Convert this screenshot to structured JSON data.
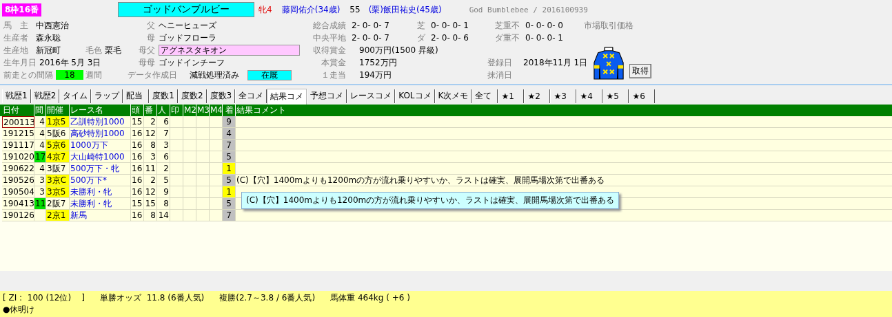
{
  "header": {
    "frame": "8枠16番",
    "horse_name": "ゴッドバンブルビー",
    "sex_age": "牝4",
    "jockey": "藤岡佑介(34歳)",
    "weight": "55",
    "trainer": "(栗)飯田祐史(45歳)",
    "english_id": "God Bumblebee / 2016100939"
  },
  "profile": {
    "owner": {
      "label": "馬　主",
      "value": "中西憲治"
    },
    "breeder": {
      "label": "生産者",
      "value": "森永聡"
    },
    "birthplace": {
      "label": "生産地",
      "value": "新冠町"
    },
    "coat": {
      "label": "毛色",
      "value": "栗毛"
    },
    "birthday": {
      "label": "生年月日",
      "value": "2016年 5月 3日"
    },
    "interval": {
      "label": "前走との間隔",
      "value": "18",
      "unit": "週間"
    },
    "pedigree": [
      {
        "label": "父",
        "value": "ヘニーヒューズ"
      },
      {
        "label": "母",
        "value": "ゴッドフローラ"
      },
      {
        "label": "母父",
        "value": "アグネスタキオン"
      },
      {
        "label": "母母",
        "value": "ゴッドインチーフ"
      }
    ],
    "data_date": {
      "label": "データ作成日",
      "value": "減戦処理済み"
    },
    "status": "在厩",
    "records": [
      {
        "label": "総合成績",
        "value": "2- 0- 0- 7"
      },
      {
        "label": "芝",
        "value": "0- 0- 0- 1"
      },
      {
        "label": "芝重不",
        "value": "0- 0- 0- 0"
      },
      {
        "label": "中央平地",
        "value": "2- 0- 0- 7"
      },
      {
        "label": "ダ",
        "value": "2- 0- 0- 6"
      },
      {
        "label": "ダ重不",
        "value": "0- 0- 0- 1"
      }
    ],
    "market_price_label": "市場取引価格",
    "earnings": [
      {
        "label": "収得賞金",
        "value": "900万円(1500 昇級)"
      },
      {
        "label": "本賞金",
        "value": "1752万円"
      },
      {
        "label": "１走当",
        "value": "194万円"
      }
    ],
    "registered": {
      "label": "登録日",
      "value": "2018年11月 1日"
    },
    "deregistered_label": "抹消日",
    "fetch_button": "取得"
  },
  "tabs": [
    {
      "label": "戦歴1",
      "selected": false
    },
    {
      "label": "戦歴2",
      "selected": false
    },
    {
      "label": "タイム",
      "selected": false
    },
    {
      "label": "ラップ",
      "selected": false
    },
    {
      "label": "配当",
      "selected": false
    },
    {
      "label": "度数1",
      "selected": false
    },
    {
      "label": "度数2",
      "selected": false
    },
    {
      "label": "度数3",
      "selected": false
    },
    {
      "label": "全コメ",
      "selected": false
    },
    {
      "label": "結果コメ",
      "selected": true
    },
    {
      "label": "予想コメ",
      "selected": false
    },
    {
      "label": "レースコメ",
      "selected": false
    },
    {
      "label": "KOLコメ",
      "selected": false
    },
    {
      "label": "K次メモ",
      "selected": false
    },
    {
      "label": "全て",
      "selected": false
    },
    {
      "label": "★1",
      "selected": false
    },
    {
      "label": "★2",
      "selected": false
    },
    {
      "label": "★3",
      "selected": false
    },
    {
      "label": "★4",
      "selected": false
    },
    {
      "label": "★5",
      "selected": false
    },
    {
      "label": "★6",
      "selected": false
    }
  ],
  "table": {
    "columns": [
      "日付",
      "間",
      "開催",
      "レース名",
      "頭",
      "番",
      "人",
      "印",
      "M2",
      "M3",
      "M4",
      "着",
      "結果コメント"
    ],
    "rows": [
      {
        "date": "200113",
        "selected": true,
        "interval": "4",
        "interval_highlight": false,
        "meeting": "1京5",
        "meeting_highlight": true,
        "race": "乙訓特別1000",
        "runners": "15",
        "number": "2",
        "popularity": "6",
        "finish": "9",
        "finish_highlight": false
      },
      {
        "date": "191215",
        "selected": false,
        "interval": "4",
        "interval_highlight": false,
        "meeting": "5阪6",
        "meeting_highlight": false,
        "race": "高砂特別1000",
        "runners": "16",
        "number": "12",
        "popularity": "7",
        "finish": "4",
        "finish_highlight": false
      },
      {
        "date": "191117",
        "selected": false,
        "interval": "4",
        "interval_highlight": false,
        "meeting": "5京6",
        "meeting_highlight": true,
        "race": "1000万下",
        "runners": "16",
        "number": "8",
        "popularity": "3",
        "finish": "7",
        "finish_highlight": false
      },
      {
        "date": "191020",
        "selected": false,
        "interval": "17",
        "interval_highlight": true,
        "meeting": "4京7",
        "meeting_highlight": true,
        "race": "大山崎特1000",
        "runners": "16",
        "number": "3",
        "popularity": "6",
        "finish": "5",
        "finish_highlight": false
      },
      {
        "date": "190622",
        "selected": false,
        "interval": "4",
        "interval_highlight": false,
        "meeting": "3阪7",
        "meeting_highlight": false,
        "race": "500万下・牝",
        "runners": "16",
        "number": "11",
        "popularity": "2",
        "finish": "1",
        "finish_highlight": true
      },
      {
        "date": "190526",
        "selected": false,
        "interval": "3",
        "interval_highlight": false,
        "meeting": "3京C",
        "meeting_highlight": true,
        "race": "500万下*",
        "runners": "16",
        "number": "2",
        "popularity": "5",
        "finish": "5",
        "finish_highlight": false,
        "comment": "(C)【穴】1400mよりも1200mの方が流れ乗りやすいか、ラストは確実、展開馬場次第で出番ある"
      },
      {
        "date": "190504",
        "selected": false,
        "interval": "3",
        "interval_highlight": false,
        "meeting": "3京5",
        "meeting_highlight": true,
        "race": "未勝利・牝",
        "runners": "16",
        "number": "12",
        "popularity": "9",
        "finish": "1",
        "finish_highlight": true
      },
      {
        "date": "190413",
        "selected": false,
        "interval": "11",
        "interval_highlight": true,
        "meeting": "2阪7",
        "meeting_highlight": false,
        "race": "未勝利・牝",
        "runners": "15",
        "number": "15",
        "popularity": "8",
        "finish": "5",
        "finish_highlight": false
      },
      {
        "date": "190126",
        "selected": false,
        "interval": "",
        "interval_highlight": false,
        "meeting": "2京1",
        "meeting_highlight": true,
        "race": "新馬",
        "runners": "16",
        "number": "8",
        "popularity": "14",
        "finish": "7",
        "finish_highlight": false
      }
    ]
  },
  "tooltip": "(C)【穴】1400mよりも1200mの方が流れ乗りやすいか、ラストは確実、展開馬場次第で出番ある",
  "status_bar": {
    "items": [
      "[ ZI :  100 (12位)    ]",
      "単勝オッズ  11.8 (6番人気)",
      "複勝(2.7～3.8 / 6番人気)",
      "馬体重 464kg ( +6 )"
    ],
    "note": "●休明け"
  }
}
